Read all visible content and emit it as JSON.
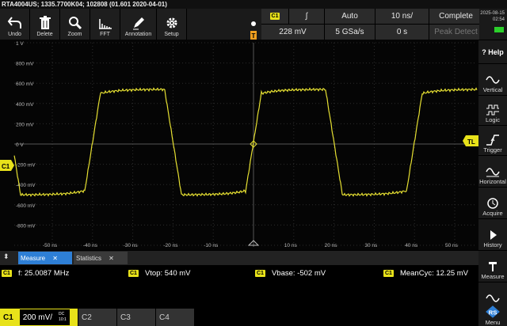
{
  "window": {
    "title": "RTA4004US; 1335.7700K04; 102808 (01.601 2020-04-01)"
  },
  "toolbar": [
    {
      "name": "undo",
      "label": "Undo",
      "icon": "undo-arrow-icon"
    },
    {
      "name": "delete",
      "label": "Delete",
      "icon": "trash-icon"
    },
    {
      "name": "zoom",
      "label": "Zoom",
      "icon": "magnifier-icon"
    },
    {
      "name": "fft",
      "label": "FFT",
      "icon": "fft-bars-icon"
    },
    {
      "name": "annotation",
      "label": "Annotation",
      "icon": "pen-icon"
    },
    {
      "name": "setup",
      "label": "Setup",
      "icon": "gear-icon"
    }
  ],
  "params": {
    "channel": "C1",
    "slope_symbol": "∫",
    "trigger_mode": "Auto",
    "time_scale": "10 ns/",
    "acq_status": "Complete",
    "trigger_level": "228 mV",
    "sample_rate": "5 GSa/s",
    "horiz_position": "0 s",
    "decimation": "Peak Detect"
  },
  "clock": {
    "date": "2025-08-15",
    "time": "02:54"
  },
  "markers": {
    "channel": "C1",
    "trigger_level": "TL",
    "trigger_pos": "T"
  },
  "y_labels": [
    "1 V",
    "800 mV",
    "600 mV",
    "400 mV",
    "200 mV",
    "0 V",
    "-200 mV",
    "-400 mV",
    "-600 mV",
    "-800 mV"
  ],
  "x_labels": [
    "-50 ns",
    "-40 ns",
    "-30 ns",
    "-20 ns",
    "-10 ns",
    "10 ns",
    "20 ns",
    "30 ns",
    "40 ns",
    "50 ns"
  ],
  "right_menu": [
    {
      "label": "Help",
      "icon": "help-icon"
    },
    {
      "label": "Vertical",
      "icon": "sine-icon"
    },
    {
      "label": "Logic",
      "icon": "logic-icon"
    },
    {
      "label": "Trigger",
      "icon": "trigger-edge-icon"
    },
    {
      "label": "Horizontal",
      "icon": "horizontal-sine-icon"
    },
    {
      "label": "Acquire",
      "icon": "acquire-icon"
    },
    {
      "label": "History",
      "icon": "play-icon"
    },
    {
      "label": "Measure",
      "icon": "measure-icon"
    },
    {
      "label": "Menu",
      "icon": "rohde-schwarz-logo-icon"
    }
  ],
  "meas_tabs": {
    "measure": "Measure",
    "statistics": "Statistics"
  },
  "measurements": [
    {
      "channel": "C1",
      "text": "f: 25.0087 MHz"
    },
    {
      "channel": "C1",
      "text": "Vtop: 540 mV"
    },
    {
      "channel": "C1",
      "text": "Vbase: -502 mV"
    },
    {
      "channel": "C1",
      "text": "MeanCyc: 12.25 mV"
    }
  ],
  "bottom": {
    "ch1": "C1",
    "ch1_scale": "200 mV/",
    "ch1_coupling": "DC",
    "ch1_bw": "10:1",
    "ch2": "C2",
    "ch3": "C3",
    "ch4": "C4"
  },
  "colors": {
    "trace": "#e6e032",
    "accent": "#2e7fd6",
    "channel_tag": "#e8e21a"
  },
  "waveform": {
    "type": "square",
    "frequency_mhz": 25.0087,
    "vtop_mv": 540,
    "vbase_mv": -502,
    "time_per_div_ns": 10,
    "volts_per_div_mv": 200
  }
}
